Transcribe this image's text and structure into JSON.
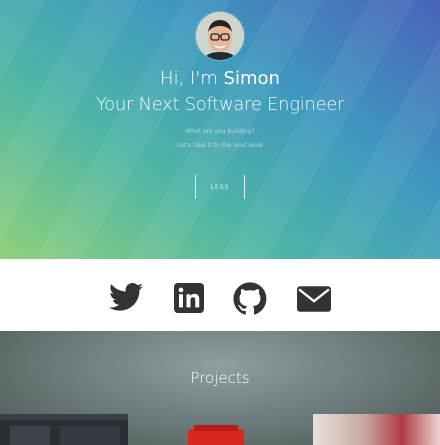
{
  "hero": {
    "greeting_prefix": "Hi, I'm ",
    "name": "Simon",
    "subtitle": "Your Next Software Engineer",
    "small_line_1": "What are you building?",
    "small_line_2": "Let's take it to the next level",
    "less_button_label": "LESS"
  },
  "social": {
    "icons": [
      "twitter-icon",
      "linkedin-icon",
      "github-icon",
      "email-icon"
    ],
    "icon_color": "#333333"
  },
  "projects": {
    "title": "Projects"
  },
  "colors": {
    "hero_gradient": [
      "#8fd07d",
      "#4fb5a6",
      "#3f99c0",
      "#4a63b9"
    ],
    "projects_bg": "#6f7f7f",
    "accent_red": "#d9261f"
  }
}
